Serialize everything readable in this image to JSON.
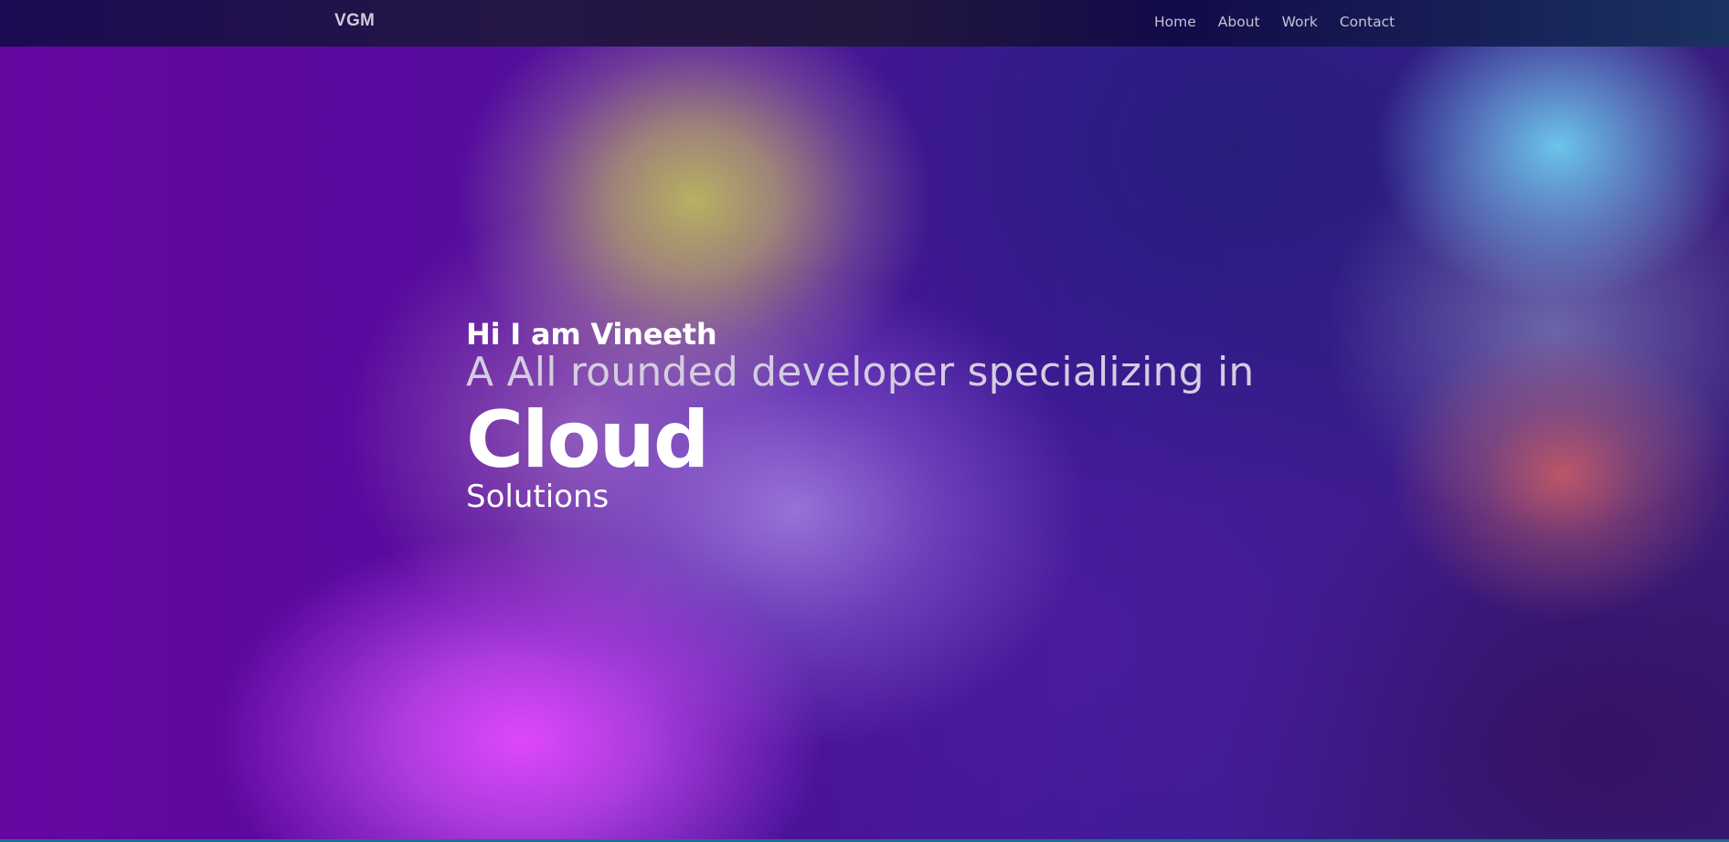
{
  "nav": {
    "logo": "VGM",
    "links": [
      {
        "label": "Home"
      },
      {
        "label": "About"
      },
      {
        "label": "Work"
      },
      {
        "label": "Contact"
      }
    ]
  },
  "hero": {
    "greeting": "Hi I am Vineeth",
    "subtitle": "A All rounded developer specializing in",
    "highlight": "Cloud",
    "suffix": "Solutions"
  },
  "colors": {
    "background_primary": "#4a0a9c",
    "text_primary": "#ffffff",
    "text_muted": "#d4cde0",
    "nav_background": "#1c0a52"
  }
}
